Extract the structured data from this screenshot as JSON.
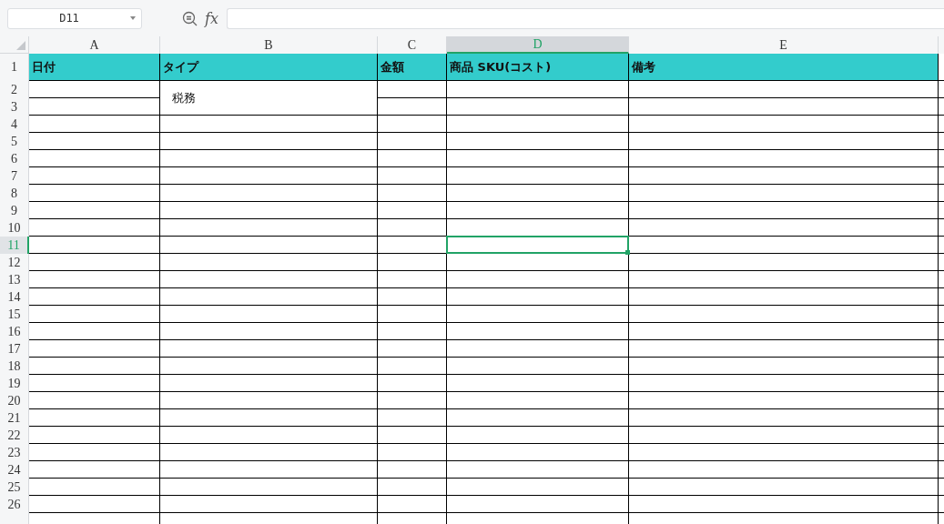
{
  "name_box": {
    "value": "D11"
  },
  "formula_bar": {
    "label": "fx"
  },
  "columns": [
    {
      "label": "A",
      "selected": false
    },
    {
      "label": "B",
      "selected": false
    },
    {
      "label": "C",
      "selected": false
    },
    {
      "label": "D",
      "selected": true
    },
    {
      "label": "E",
      "selected": false
    }
  ],
  "header_cells": [
    "日付",
    "タイプ",
    "金額",
    "商品 SKU(コスト)",
    "備考"
  ],
  "merged_cell": {
    "text": "税務"
  },
  "row_headers": [
    {
      "label": "1",
      "selected": false
    },
    {
      "label": "2",
      "selected": false
    },
    {
      "label": "3",
      "selected": false
    },
    {
      "label": "4",
      "selected": false
    },
    {
      "label": "5",
      "selected": false
    },
    {
      "label": "6",
      "selected": false
    },
    {
      "label": "7",
      "selected": false
    },
    {
      "label": "8",
      "selected": false
    },
    {
      "label": "9",
      "selected": false
    },
    {
      "label": "10",
      "selected": false
    },
    {
      "label": "11",
      "selected": true
    },
    {
      "label": "12",
      "selected": false
    },
    {
      "label": "13",
      "selected": false
    },
    {
      "label": "14",
      "selected": false
    },
    {
      "label": "15",
      "selected": false
    },
    {
      "label": "16",
      "selected": false
    },
    {
      "label": "17",
      "selected": false
    },
    {
      "label": "18",
      "selected": false
    },
    {
      "label": "19",
      "selected": false
    },
    {
      "label": "20",
      "selected": false
    },
    {
      "label": "21",
      "selected": false
    },
    {
      "label": "22",
      "selected": false
    },
    {
      "label": "23",
      "selected": false
    },
    {
      "label": "24",
      "selected": false
    },
    {
      "label": "25",
      "selected": false
    },
    {
      "label": "26",
      "selected": false
    }
  ]
}
